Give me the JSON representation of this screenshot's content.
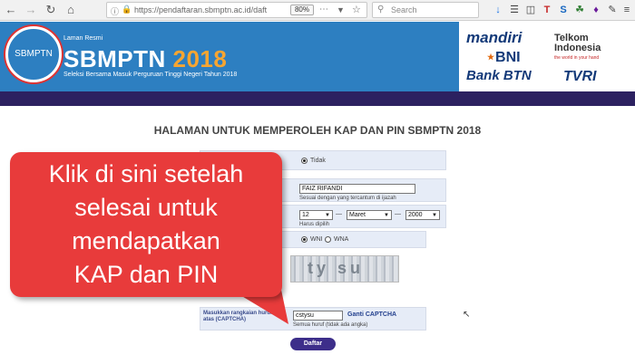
{
  "browser": {
    "url": "https://pendaftaran.sbmptn.ac.id/daft",
    "zoom": "80%",
    "search_placeholder": "Search"
  },
  "header": {
    "logo_text": "SBMPTN",
    "laman": "Laman Resmi",
    "brand": "SBMPTN",
    "year": "2018",
    "tagline": "Seleksi Bersama Masuk Perguruan Tinggi Negeri Tahun 2018",
    "sponsors": {
      "mandiri": "mandiri",
      "bni": "BNI",
      "btn": "Bank BTN",
      "telkom": "Telkom Indonesia",
      "telkom_sub": "the world in your hand",
      "tvri": "TVRI"
    }
  },
  "page_title": "HALAMAN UNTUK MEMPEROLEH KAP DAN PIN SBMPTN 2018",
  "form": {
    "radio_tidak": "Tidak",
    "name_value": "FAIZ RIFANDI",
    "name_hint": "Sesuai dengan yang tercantum di ijazah",
    "day": "12",
    "month": "Maret",
    "year": "2000",
    "date_sep1": "—",
    "date_sep2": "—",
    "date_hint": "Harus dipilih",
    "wni": "WNI",
    "wna": "WNA",
    "captcha_image_text": "ty su",
    "captcha_label": "Masukkan rangkaian huruf di atas (CAPTCHA)",
    "captcha_value": "cstysu",
    "captcha_link": "Ganti CAPTCHA",
    "captcha_hint": "Semua huruf (tidak ada angka)",
    "submit": "Daftar"
  },
  "callout": {
    "line1": "Klik di sini setelah",
    "line2": "selesai untuk",
    "line3": "mendapatkan",
    "line4": "KAP dan PIN"
  },
  "colors": {
    "header_blue": "#2d7fc1",
    "purple_bar": "#2c2160",
    "callout_red": "#e83b3b",
    "button_purple": "#3d2e8a"
  }
}
